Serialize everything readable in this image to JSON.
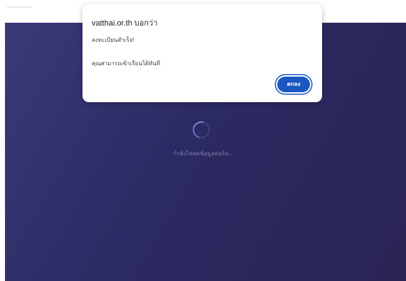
{
  "dialog": {
    "title": "vatthai.or.th บอกว่า",
    "line1": "ลงทะเบียนสำเร็จ!",
    "line2": "คุณสามารถเข้าเรียนได้ทันที",
    "ok_label": "ตกลง"
  },
  "page": {
    "loading_text": "กำลังโหลดข้อมูลคอร์ส..."
  },
  "colors": {
    "accent": "#1a57c4",
    "page_background": "#2c2a63"
  }
}
